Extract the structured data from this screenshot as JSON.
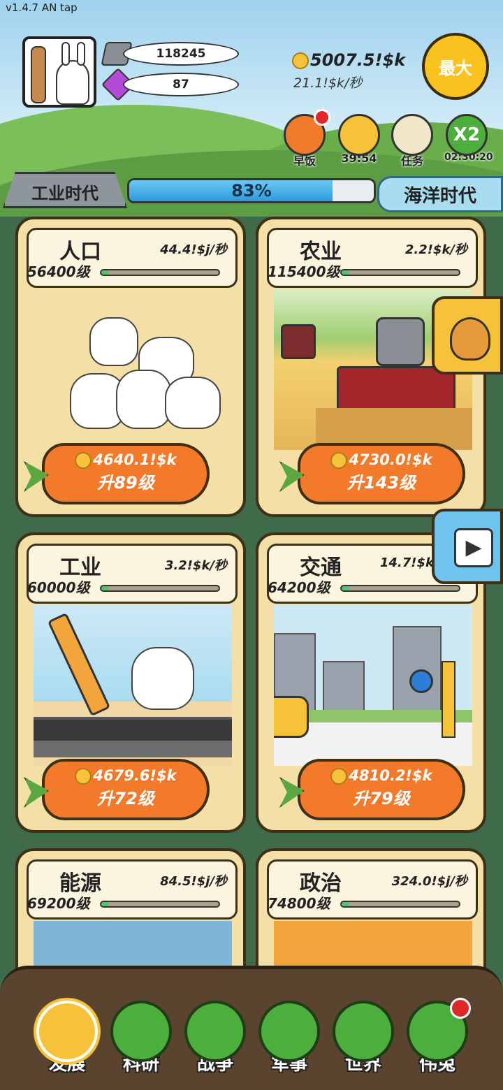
{
  "version_label": "v1.4.7 AN tap",
  "resources": {
    "ingots": "118245",
    "gems": "87"
  },
  "money": {
    "total": "5007.5!$k",
    "rate": "21.1!$k/秒"
  },
  "max_button": "最大",
  "quick_actions": [
    {
      "label": "早饭",
      "color": "#f27a2b"
    },
    {
      "label": "39:54",
      "color": "#f6c23a"
    },
    {
      "label": "任务",
      "color": "#f0e6c8"
    },
    {
      "label": "02:30:20",
      "color": "#4cae3c",
      "badge": "X2"
    }
  ],
  "era": {
    "current": "工业时代",
    "progress_pct": 83,
    "progress_label": "83%",
    "next": "海洋时代"
  },
  "cards": [
    {
      "name": "人口",
      "rate": "44.4!$j/秒",
      "level": "56400级",
      "cost": "4640.1!$k",
      "upgrade": "升89级"
    },
    {
      "name": "农业",
      "rate": "2.2!$k/秒",
      "level": "115400级",
      "cost": "4730.0!$k",
      "upgrade": "升143级"
    },
    {
      "name": "工业",
      "rate": "3.2!$k/秒",
      "level": "60000级",
      "cost": "4679.6!$k",
      "upgrade": "升72级"
    },
    {
      "name": "交通",
      "rate": "14.7!$k",
      "level": "64200级",
      "cost": "4810.2!$k",
      "upgrade": "升79级"
    },
    {
      "name": "能源",
      "rate": "84.5!$j/秒",
      "level": "69200级"
    },
    {
      "name": "政治",
      "rate": "324.0!$j/秒",
      "level": "74800级"
    }
  ],
  "nav": [
    {
      "label": "发展"
    },
    {
      "label": "科研"
    },
    {
      "label": "战争"
    },
    {
      "label": "军事"
    },
    {
      "label": "世界"
    },
    {
      "label": "伟兔"
    }
  ]
}
